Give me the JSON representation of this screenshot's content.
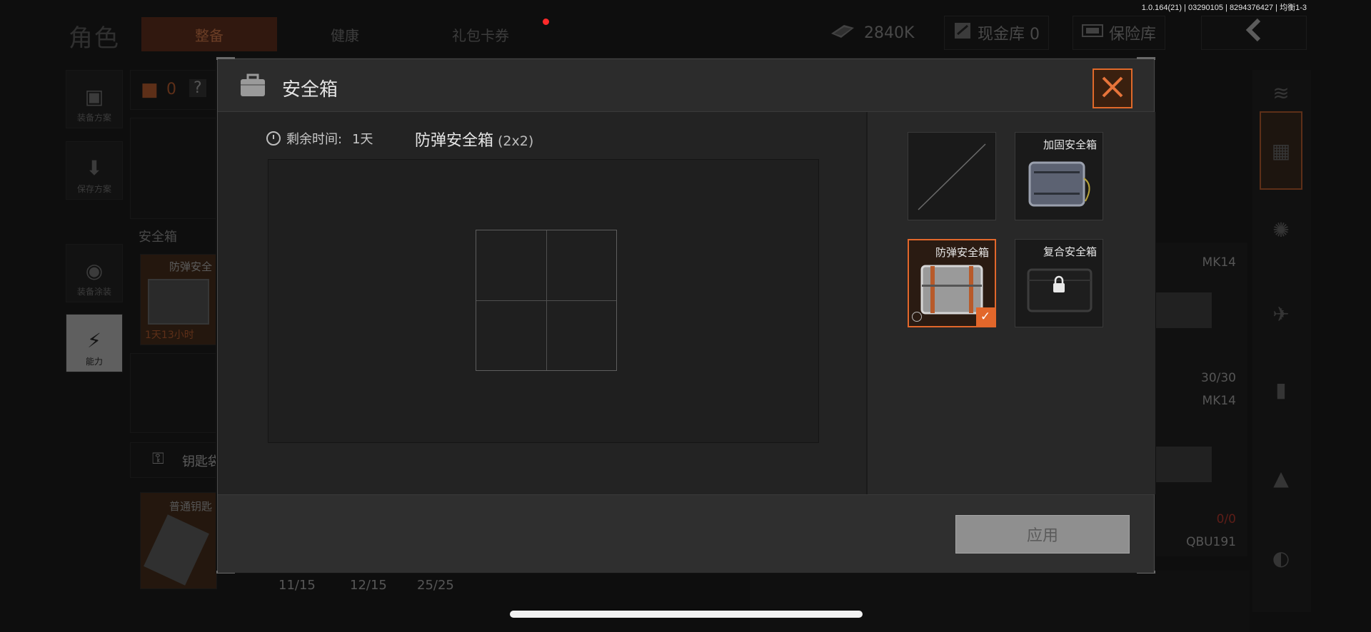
{
  "background": {
    "version": "1.0.164(21) | 03290105 | 8294376427 | 均衡1-3",
    "page_title": "角色",
    "tabs": [
      "整备",
      "健康",
      "礼包卡券"
    ],
    "money": "2840K",
    "gold_vault": "现金库 0",
    "insurance_vault": "保险库",
    "sidebar": [
      "装备方案",
      "保存方案",
      "装备涂装",
      "能力"
    ],
    "armor_count": "0",
    "help": "?",
    "safe_box_heading": "安全箱",
    "safe_box_name": "防弹安全",
    "safe_box_timer": "1天13小时",
    "key_bag": "钥匙袋",
    "normal_key": "普通钥匙",
    "ammo": [
      "11/15",
      "12/15",
      "25/25"
    ],
    "weapons": [
      "MK14",
      "MK14",
      "QBU191"
    ],
    "weapon_ammo": [
      "30/30",
      "0/0"
    ]
  },
  "modal": {
    "title": "安全箱",
    "remaining_label": "剩余时间:",
    "remaining_value": "1天",
    "current_case": "防弹安全箱",
    "current_size": "(2x2)",
    "cases": [
      {
        "name": "加固安全箱",
        "selected": false,
        "locked": false
      },
      {
        "name": "防弹安全箱",
        "selected": true,
        "locked": false
      },
      {
        "name": "复合安全箱",
        "selected": false,
        "locked": true
      }
    ],
    "apply": "应用"
  },
  "colors": {
    "accent": "#e2672b",
    "panel": "#262626",
    "button_disabled": "#8f8f8f"
  }
}
